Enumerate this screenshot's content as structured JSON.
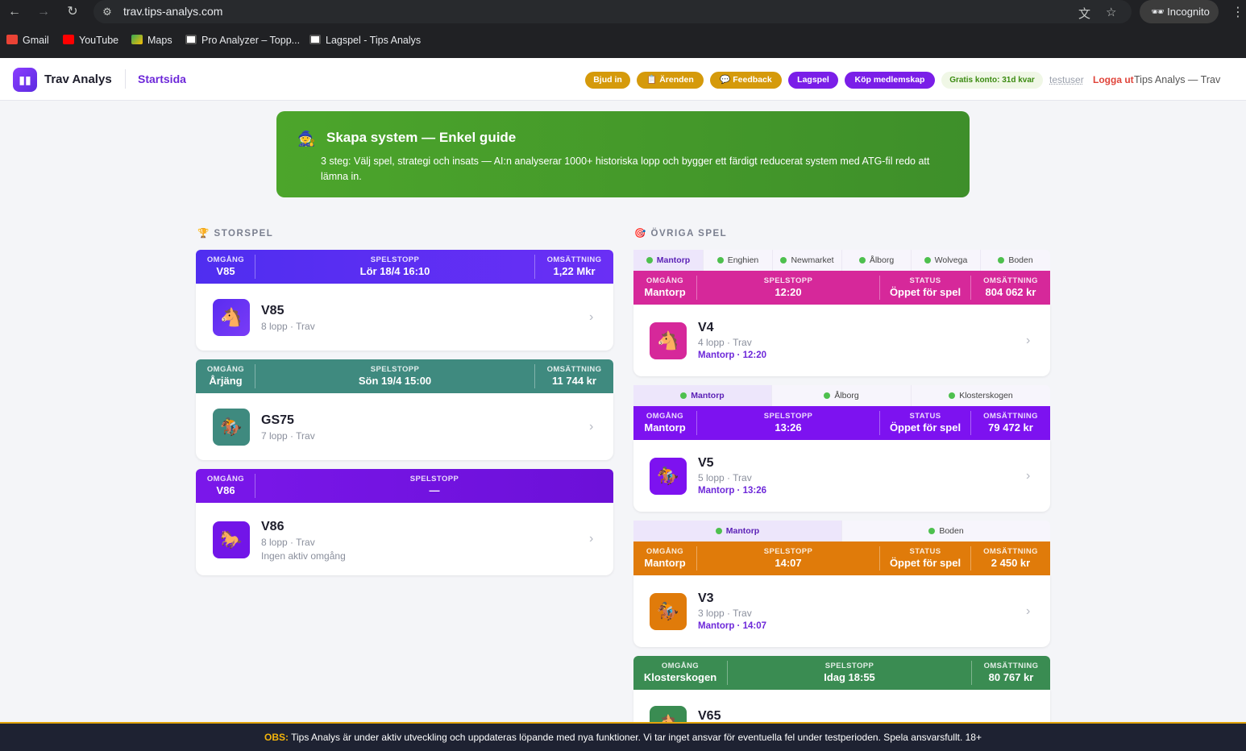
{
  "browser": {
    "url": "trav.tips-analys.com",
    "incognito_label": "Incognito",
    "bookmarks": [
      {
        "label": "Gmail"
      },
      {
        "label": "YouTube"
      },
      {
        "label": "Maps"
      },
      {
        "label": "Pro Analyzer – Topp..."
      },
      {
        "label": "Lagspel - Tips Analys"
      }
    ]
  },
  "header": {
    "brand": "Trav Analys",
    "nav_link": "Startsida",
    "pills": {
      "invite": "Bjud in",
      "cases": "📋 Ärenden",
      "feedback": "💬 Feedback",
      "team": "Lagspel",
      "buy": "Köp medlemskap",
      "free_account": "Gratis konto: 31d kvar"
    },
    "username": "testuser",
    "logout": "Logga ut",
    "site_title": "Tips Analys — Trav"
  },
  "guide": {
    "icon": "🧙",
    "title": "Skapa system — Enkel guide",
    "text": "3 steg: Välj spel, strategi och insats — AI:n analyserar 1000+ historiska lopp och bygger ett färdigt reducerat system med ATG-fil redo att lämna in."
  },
  "storspel": {
    "icon": "🏆",
    "heading": "STORSPEL",
    "games": [
      {
        "omgang_label": "OMGÅNG",
        "omgang": "V85",
        "spelstopp_label": "SPELSTOPP",
        "spelstopp": "Lör 18/4 16:10",
        "oms_label": "OMSÄTTNING",
        "oms": "1,22 Mkr",
        "name": "V85",
        "sub": "8 lopp · Trav",
        "icon": "🐴",
        "color": "#5b2ef0"
      },
      {
        "omgang_label": "OMGÅNG",
        "omgang": "Årjäng",
        "spelstopp_label": "SPELSTOPP",
        "spelstopp": "Sön 19/4 15:00",
        "oms_label": "OMSÄTTNING",
        "oms": "11 744 kr",
        "name": "GS75",
        "sub": "7 lopp · Trav",
        "icon": "🏇",
        "color": "#3f8a7f"
      },
      {
        "omgang_label": "OMGÅNG",
        "omgang": "V86",
        "spelstopp_label": "SPELSTOPP",
        "spelstopp": "—",
        "name": "V86",
        "sub": "8 lopp · Trav",
        "note": "Ingen aktiv omgång",
        "icon": "🐎",
        "color": "#7215e8"
      }
    ]
  },
  "ovriga": {
    "icon": "🎯",
    "heading": "ÖVRIGA SPEL",
    "groups": [
      {
        "tabs": [
          "Mantorp",
          "Enghien",
          "Newmarket",
          "Ålborg",
          "Wolvega",
          "Boden"
        ],
        "omgang_label": "OMGÅNG",
        "omgang": "Mantorp",
        "spelstopp_label": "SPELSTOPP",
        "spelstopp": "12:20",
        "status_label": "STATUS",
        "status": "Öppet för spel",
        "oms_label": "OMSÄTTNING",
        "oms": "804 062 kr",
        "name": "V4",
        "sub": "4 lopp · Trav",
        "track": "Mantorp · 12:20",
        "icon": "🐴",
        "color": "#d6289a"
      },
      {
        "tabs": [
          "Mantorp",
          "Ålborg",
          "Klosterskogen"
        ],
        "omgang_label": "OMGÅNG",
        "omgang": "Mantorp",
        "spelstopp_label": "SPELSTOPP",
        "spelstopp": "13:26",
        "status_label": "STATUS",
        "status": "Öppet för spel",
        "oms_label": "OMSÄTTNING",
        "oms": "79 472 kr",
        "name": "V5",
        "sub": "5 lopp · Trav",
        "track": "Mantorp · 13:26",
        "icon": "🏇",
        "color": "#7d12f0"
      },
      {
        "tabs": [
          "Mantorp",
          "Boden"
        ],
        "omgang_label": "OMGÅNG",
        "omgang": "Mantorp",
        "spelstopp_label": "SPELSTOPP",
        "spelstopp": "14:07",
        "status_label": "STATUS",
        "status": "Öppet för spel",
        "oms_label": "OMSÄTTNING",
        "oms": "2 450 kr",
        "name": "V3",
        "sub": "3 lopp · Trav",
        "track": "Mantorp · 14:07",
        "icon": "🏇",
        "color": "#e07b0a"
      },
      {
        "omgang_label": "OMGÅNG",
        "omgang": "Klosterskogen",
        "spelstopp_label": "SPELSTOPP",
        "spelstopp": "Idag 18:55",
        "oms_label": "OMSÄTTNING",
        "oms": "80 767 kr",
        "name": "V65",
        "icon": "🐴",
        "color": "#3a8c52"
      }
    ]
  },
  "footer": {
    "label": "OBS:",
    "text": " Tips Analys är under aktiv utveckling och uppdateras löpande med nya funktioner. Vi tar inget ansvar för eventuella fel under testperioden. Spela ansvarsfullt. 18+"
  }
}
